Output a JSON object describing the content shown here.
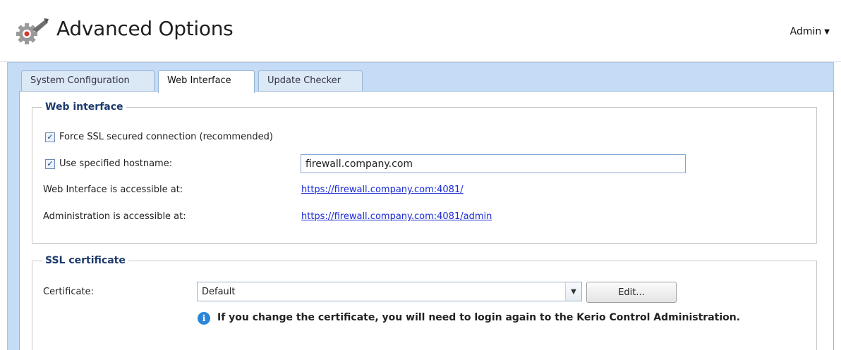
{
  "header": {
    "title": "Advanced Options",
    "user_label": "Admin",
    "app_icon": "gear-wrench-icon"
  },
  "tabs": [
    {
      "label": "System Configuration",
      "active": false
    },
    {
      "label": "Web Interface",
      "active": true
    },
    {
      "label": "Update Checker",
      "active": false
    }
  ],
  "web_interface": {
    "legend": "Web interface",
    "force_ssl": {
      "label": "Force SSL secured connection (recommended)",
      "checked": true
    },
    "use_hostname": {
      "label": "Use specified hostname:",
      "checked": true,
      "value": "firewall.company.com"
    },
    "web_access_label": "Web Interface is accessible at:",
    "web_access_url": "https://firewall.company.com:4081/",
    "admin_access_label": "Administration is accessible at:",
    "admin_access_url": "https://firewall.company.com:4081/admin"
  },
  "ssl": {
    "legend": "SSL certificate",
    "certificate_label": "Certificate:",
    "certificate_value": "Default",
    "edit_button": "Edit...",
    "info_text": "If you change the certificate, you will need to login again to the Kerio Control Administration."
  },
  "colors": {
    "accent": "#2b86d9",
    "panel_bg": "#c4dcf5",
    "link": "#1a2bd6",
    "legend": "#1d3a6e"
  }
}
